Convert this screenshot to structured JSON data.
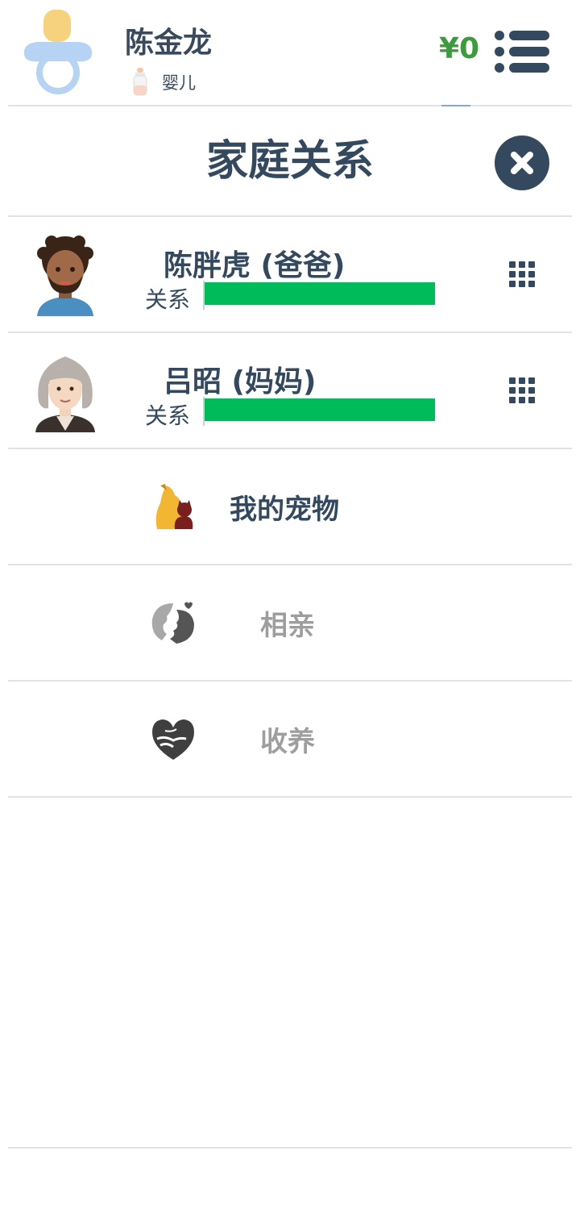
{
  "header": {
    "user_name": "陈金龙",
    "stage_label": "婴儿",
    "money": "¥0"
  },
  "panel": {
    "title": "家庭关系"
  },
  "family": [
    {
      "name": "陈胖虎 (爸爸)",
      "relation_label": "关系",
      "relation_level": 1.0
    },
    {
      "name": "吕昭 (妈妈)",
      "relation_label": "关系",
      "relation_level": 1.0
    }
  ],
  "menu": [
    {
      "label": "我的宠物",
      "icon": "pet-icon",
      "enabled": true
    },
    {
      "label": "相亲",
      "icon": "blind-date-icon",
      "enabled": false
    },
    {
      "label": "收养",
      "icon": "adoption-heart-icon",
      "enabled": false
    }
  ],
  "colors": {
    "accent_green": "#00bb5a",
    "money_green": "#3e9a3e",
    "text_dark": "#34495e",
    "text_disabled": "#9e9e9e"
  }
}
